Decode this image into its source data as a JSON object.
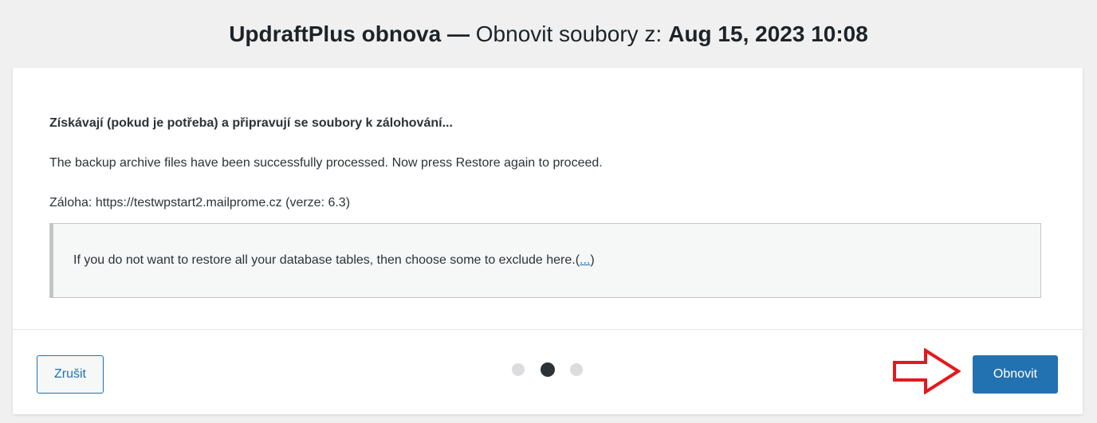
{
  "title": {
    "app_name": "UpdraftPlus obnova",
    "separator": " — ",
    "action": "Obnovit soubory z:",
    "date": "Aug 15, 2023 10:08"
  },
  "content": {
    "heading": "Získávají (pokud je potřeba) a připravují se soubory k zálohování...",
    "processed_message": "The backup archive files have been successfully processed. Now press Restore again to proceed.",
    "backup_info": "Záloha: https://testwpstart2.mailprome.cz (verze: 6.3)",
    "notice": {
      "text": "If you do not want to restore all your database tables, then choose some to exclude here.",
      "link_open": "(",
      "link_label": "...",
      "link_close": ")"
    }
  },
  "footer": {
    "cancel_label": "Zrušit",
    "restore_label": "Obnovit",
    "steps": {
      "total": 3,
      "current": 2
    },
    "pointer_arrow": {
      "icon": "right-arrow-outline-icon",
      "color": "#e3191b"
    }
  },
  "colors": {
    "primary": "#2271b1",
    "background": "#f0f0f1",
    "dialog": "#ffffff",
    "text": "#2c3338"
  }
}
